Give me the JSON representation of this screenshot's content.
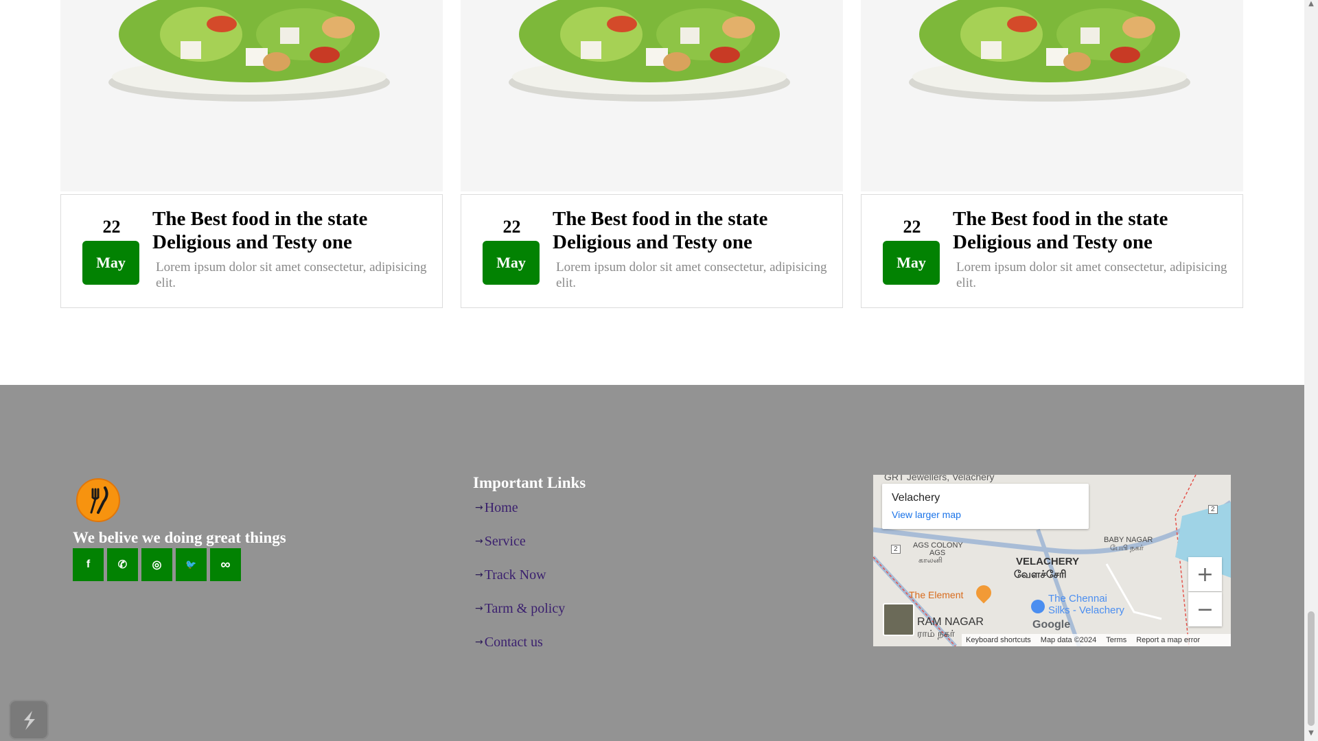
{
  "cards": [
    {
      "day": "22",
      "month": "May",
      "title_line1": "The Best food in the state",
      "title_line2": "Deligious and Testy one",
      "desc": "Lorem ipsum dolor sit amet consectetur, adipisicing elit."
    },
    {
      "day": "22",
      "month": "May",
      "title_line1": "The Best food in the state",
      "title_line2": "Deligious and Testy one",
      "desc": "Lorem ipsum dolor sit amet consectetur, adipisicing elit."
    },
    {
      "day": "22",
      "month": "May",
      "title_line1": "The Best food in the state",
      "title_line2": "Deligious and Testy one",
      "desc": "Lorem ipsum dolor sit amet consectetur, adipisicing elit."
    }
  ],
  "footer": {
    "tagline": "We belive we doing great things",
    "social": [
      {
        "icon": "facebook-icon",
        "glyph": "f"
      },
      {
        "icon": "whatsapp-icon",
        "glyph": "✆"
      },
      {
        "icon": "instagram-icon",
        "glyph": "◎"
      },
      {
        "icon": "twitter-icon",
        "glyph": "🐦"
      },
      {
        "icon": "meta-icon",
        "glyph": "∞"
      }
    ],
    "links_heading": "Important Links",
    "links": [
      "Home",
      "Service",
      "Track Now",
      "Tarm & policy",
      "Contact us"
    ]
  },
  "map": {
    "place": "Velachery",
    "larger_map": "View larger map",
    "labels": {
      "top_partial": "GRT Jewellers, Velachery",
      "ags_colony": "AGS COLONY",
      "ags": "AGS",
      "ags_tamil": "காலனி",
      "baby_nagar": "BABY NAGAR",
      "baby_nagar_tamil": "பேபி நகர்",
      "velachery": "VELACHERY",
      "velachery_tamil": "வேளச்சேரி",
      "the_element": "The Element",
      "chennai_silks_1": "The Chennai",
      "chennai_silks_2": "Silks - Velachery",
      "ram_nagar": "RAM NAGAR",
      "ram_nagar_tamil": "ராம் நகர்",
      "google": "Google",
      "route_2": "2"
    },
    "footer": [
      "Keyboard shortcuts",
      "Map data ©2024",
      "Terms",
      "Report a map error"
    ],
    "zoom_in": "+",
    "zoom_out": "−"
  },
  "colors": {
    "accent_green": "#028202",
    "footer_bg": "#939393",
    "link_color": "#3a1f6e",
    "logo_orange": "#f7930f"
  }
}
